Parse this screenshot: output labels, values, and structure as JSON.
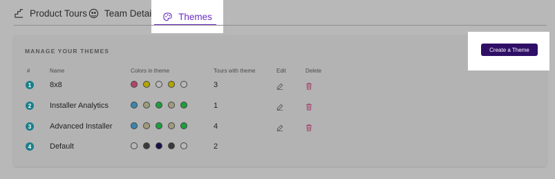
{
  "tabs": [
    {
      "label": "Product Tours",
      "icon": "tour-icon"
    },
    {
      "label": "Team Details",
      "icon": "team-icon"
    },
    {
      "label": "Themes",
      "icon": "palette-icon",
      "active": true
    }
  ],
  "colors": {
    "accent": "#6a2fc4",
    "button": "#2f0f66",
    "badge": "#1a7f8a",
    "delete": "#a03e6a"
  },
  "section": {
    "title": "MANAGE YOUR THEMES",
    "create_button": "Create a Theme",
    "columns": {
      "index": "#",
      "name": "Name",
      "colors": "Colors in theme",
      "tours": "Tours with theme",
      "edit": "Edit",
      "delete": "Delete"
    }
  },
  "themes": [
    {
      "index": "1",
      "name": "8x8",
      "colors": [
        "#b0456a",
        "#b2a500",
        "#b8b8b8",
        "#b2a500",
        "#b8b8b8"
      ],
      "tours": "3",
      "editable": true
    },
    {
      "index": "2",
      "name": "Installer Analytics",
      "colors": [
        "#3a86ad",
        "#9e9b7e",
        "#1e9e3e",
        "#9e9b7e",
        "#1e9e3e"
      ],
      "tours": "1",
      "editable": true
    },
    {
      "index": "3",
      "name": "Advanced Installer",
      "colors": [
        "#3a86ad",
        "#9e9b7e",
        "#1e9e3e",
        "#9e9b7e",
        "#1e9e3e"
      ],
      "tours": "4",
      "editable": true
    },
    {
      "index": "4",
      "name": "Default",
      "colors": [
        "#b8b8b8",
        "#3a3a3a",
        "#1a0f4a",
        "#3a3a3a",
        "#b8b8b8"
      ],
      "tours": "2",
      "editable": false
    }
  ]
}
